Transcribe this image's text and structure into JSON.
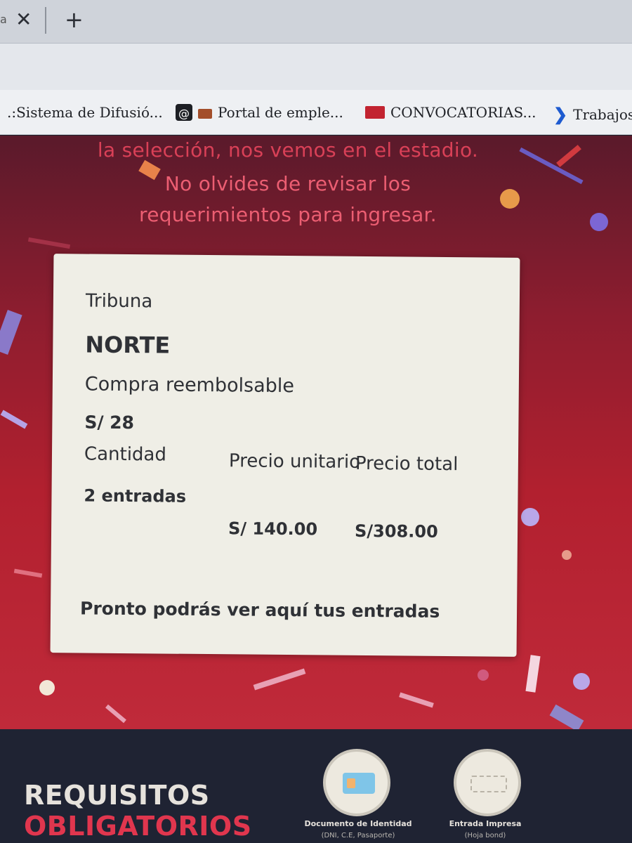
{
  "browser": {
    "tab_edge_text": "a",
    "close_glyph": "✕",
    "new_tab_glyph": "+",
    "bookmarks": [
      {
        "label": ".:Sistema de Difusió...",
        "icon": "none"
      },
      {
        "label": "Portal de emple...",
        "icon": "briefcase-icon"
      },
      {
        "label": "CONVOCATORIAS...",
        "icon": "stamp-icon"
      },
      {
        "label": "Trabajos",
        "icon": "chevron-icon"
      }
    ],
    "at_icon_glyph": "@"
  },
  "hero": {
    "line1": "la selección, nos vemos en el estadio.",
    "line2": "No olvides de revisar los",
    "line3": "requerimientos para ingresar."
  },
  "ticket": {
    "zone_label": "Tribuna",
    "zone_value": "NORTE",
    "purchase_type": "Compra reembolsable",
    "base_price": "S/ 28",
    "headers": {
      "quantity": "Cantidad",
      "unit_price": "Precio unitario",
      "total_price": "Precio total"
    },
    "values": {
      "quantity": "2 entradas",
      "unit_price": "S/ 140.00",
      "total_price": "S/308.00"
    },
    "footer_note": "Pronto podrás ver aquí tus entradas"
  },
  "requirements": {
    "title_line1": "REQUISITOS",
    "title_line2": "OBLIGATORIOS",
    "items": [
      {
        "label": "Documento de Identidad",
        "sub": "(DNI, C.E, Pasaporte)",
        "icon": "id-card-icon"
      },
      {
        "label": "Entrada Impresa",
        "sub": "(Hoja bond)",
        "icon": "printed-ticket-icon"
      }
    ]
  },
  "colors": {
    "hero_red": "#b2202f",
    "hero_text": "#ec5e72",
    "card_bg": "#efeee6",
    "band_dark": "#1f2333",
    "accent_red": "#e0364e"
  }
}
